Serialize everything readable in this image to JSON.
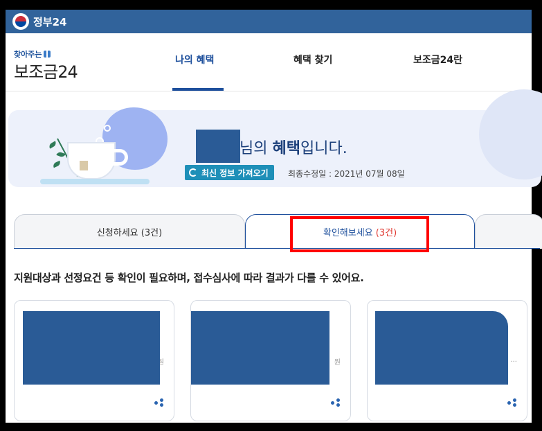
{
  "gov_bar": {
    "title": "정부24"
  },
  "brand": {
    "top": "찾아주는",
    "main": "보조금24"
  },
  "nav": {
    "tabs": [
      {
        "label": "나의 혜택",
        "active": true
      },
      {
        "label": "혜택 찾기",
        "active": false
      },
      {
        "label": "보조금24란",
        "active": false
      }
    ]
  },
  "banner": {
    "greeting_suffix_a": "님의 ",
    "greeting_bold": "혜택",
    "greeting_suffix_b": "입니다.",
    "refresh_label": "최신 정보 가져오기",
    "updated": "최종수정일 : 2021년 07월 08일"
  },
  "tabs": [
    {
      "label": "신청하세요",
      "count": "(3건)",
      "active": false
    },
    {
      "label": "확인해보세요",
      "count": "(3건)",
      "active": true
    }
  ],
  "description": "지원대상과 선정요건 등 확인이 필요하며, 접수심사에 따라 결과가 다를 수 있어요.",
  "cards": [
    {
      "tail": "원"
    },
    {
      "tail": "원"
    },
    {
      "tail": "..."
    }
  ],
  "colors": {
    "gov_bar": "#31639b",
    "accent": "#1d4f9c",
    "highlight": "#ff0000",
    "redaction": "#2a5b96"
  }
}
